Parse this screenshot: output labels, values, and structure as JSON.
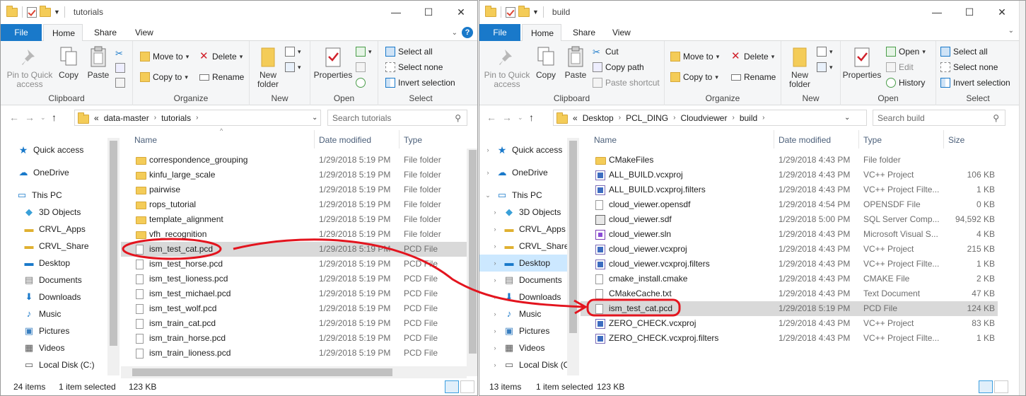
{
  "colors": {
    "accent": "#1979ca",
    "folder": "#f4cc58",
    "selected_row": "#d9d9d9",
    "nav_selected": "#cce8ff",
    "annotation": "#e3141e"
  },
  "left": {
    "title": "tutorials",
    "tabs": [
      "File",
      "Home",
      "Share",
      "View"
    ],
    "ribbon": {
      "clipboard": {
        "label": "Clipboard",
        "pin": "Pin to Quick access",
        "copy": "Copy",
        "paste": "Paste"
      },
      "organize": {
        "label": "Organize",
        "move_to": "Move to",
        "copy_to": "Copy to",
        "delete": "Delete",
        "rename": "Rename"
      },
      "new": {
        "label": "New",
        "new_folder": "New folder"
      },
      "open": {
        "label": "Open",
        "properties": "Properties"
      },
      "select": {
        "label": "Select",
        "select_all": "Select all",
        "select_none": "Select none",
        "invert": "Invert selection"
      }
    },
    "breadcrumb": [
      "«",
      "data-master",
      "tutorials"
    ],
    "search_placeholder": "Search tutorials",
    "nav": [
      {
        "label": "Quick access",
        "icon": "star-icon"
      },
      {
        "label": "OneDrive",
        "icon": "cloud-icon"
      },
      {
        "label": "This PC",
        "icon": "pc-icon"
      },
      {
        "label": "3D Objects",
        "icon": "cube-icon"
      },
      {
        "label": "CRVL_Apps",
        "icon": "folder-icon"
      },
      {
        "label": "CRVL_Share",
        "icon": "folder-icon"
      },
      {
        "label": "Desktop",
        "icon": "desktop-icon"
      },
      {
        "label": "Documents",
        "icon": "documents-icon"
      },
      {
        "label": "Downloads",
        "icon": "download-icon"
      },
      {
        "label": "Music",
        "icon": "music-icon"
      },
      {
        "label": "Pictures",
        "icon": "pictures-icon"
      },
      {
        "label": "Videos",
        "icon": "videos-icon"
      },
      {
        "label": "Local Disk (C:)",
        "icon": "disk-icon"
      }
    ],
    "columns": {
      "name": "Name",
      "date": "Date modified",
      "type": "Type"
    },
    "files": [
      {
        "name": "correspondence_grouping",
        "date": "1/29/2018 5:19 PM",
        "type": "File folder",
        "kind": "folder"
      },
      {
        "name": "kinfu_large_scale",
        "date": "1/29/2018 5:19 PM",
        "type": "File folder",
        "kind": "folder"
      },
      {
        "name": "pairwise",
        "date": "1/29/2018 5:19 PM",
        "type": "File folder",
        "kind": "folder"
      },
      {
        "name": "rops_tutorial",
        "date": "1/29/2018 5:19 PM",
        "type": "File folder",
        "kind": "folder"
      },
      {
        "name": "template_alignment",
        "date": "1/29/2018 5:19 PM",
        "type": "File folder",
        "kind": "folder"
      },
      {
        "name": "vfh_recognition",
        "date": "1/29/2018 5:19 PM",
        "type": "File folder",
        "kind": "folder"
      },
      {
        "name": "ism_test_cat.pcd",
        "date": "1/29/2018 5:19 PM",
        "type": "PCD File",
        "kind": "doc",
        "selected": true
      },
      {
        "name": "ism_test_horse.pcd",
        "date": "1/29/2018 5:19 PM",
        "type": "PCD File",
        "kind": "doc"
      },
      {
        "name": "ism_test_lioness.pcd",
        "date": "1/29/2018 5:19 PM",
        "type": "PCD File",
        "kind": "doc"
      },
      {
        "name": "ism_test_michael.pcd",
        "date": "1/29/2018 5:19 PM",
        "type": "PCD File",
        "kind": "doc"
      },
      {
        "name": "ism_test_wolf.pcd",
        "date": "1/29/2018 5:19 PM",
        "type": "PCD File",
        "kind": "doc"
      },
      {
        "name": "ism_train_cat.pcd",
        "date": "1/29/2018 5:19 PM",
        "type": "PCD File",
        "kind": "doc"
      },
      {
        "name": "ism_train_horse.pcd",
        "date": "1/29/2018 5:19 PM",
        "type": "PCD File",
        "kind": "doc"
      },
      {
        "name": "ism_train_lioness.pcd",
        "date": "1/29/2018 5:19 PM",
        "type": "PCD File",
        "kind": "doc"
      }
    ],
    "status": {
      "count": "24 items",
      "selected": "1 item selected",
      "size": "123 KB"
    }
  },
  "right": {
    "title": "build",
    "tabs": [
      "File",
      "Home",
      "Share",
      "View"
    ],
    "ribbon": {
      "clipboard": {
        "label": "Clipboard",
        "pin": "Pin to Quick access",
        "copy": "Copy",
        "paste": "Paste",
        "cut": "Cut",
        "copy_path": "Copy path",
        "paste_shortcut": "Paste shortcut"
      },
      "organize": {
        "label": "Organize",
        "move_to": "Move to",
        "copy_to": "Copy to",
        "delete": "Delete",
        "rename": "Rename"
      },
      "new": {
        "label": "New",
        "new_folder": "New folder"
      },
      "open": {
        "label": "Open",
        "properties": "Properties",
        "open": "Open",
        "edit": "Edit",
        "history": "History"
      },
      "select": {
        "label": "Select",
        "select_all": "Select all",
        "select_none": "Select none",
        "invert": "Invert selection"
      }
    },
    "breadcrumb": [
      "«",
      "Desktop",
      "PCL_DING",
      "Cloudviewer",
      "build"
    ],
    "search_placeholder": "Search build",
    "nav": [
      {
        "label": "Quick access",
        "icon": "star-icon",
        "exp": "›"
      },
      {
        "label": "OneDrive",
        "icon": "cloud-icon",
        "exp": "›"
      },
      {
        "label": "This PC",
        "icon": "pc-icon",
        "exp": "⌄"
      },
      {
        "label": "3D Objects",
        "icon": "cube-icon",
        "exp": "›"
      },
      {
        "label": "CRVL_Apps",
        "icon": "folder-icon",
        "exp": "›"
      },
      {
        "label": "CRVL_Share",
        "icon": "folder-icon",
        "exp": "›"
      },
      {
        "label": "Desktop",
        "icon": "desktop-icon",
        "exp": "›",
        "selected": true
      },
      {
        "label": "Documents",
        "icon": "documents-icon",
        "exp": "›"
      },
      {
        "label": "Downloads",
        "icon": "download-icon",
        "exp": "›"
      },
      {
        "label": "Music",
        "icon": "music-icon",
        "exp": "›"
      },
      {
        "label": "Pictures",
        "icon": "pictures-icon",
        "exp": "›"
      },
      {
        "label": "Videos",
        "icon": "videos-icon",
        "exp": "›"
      },
      {
        "label": "Local Disk (C:",
        "icon": "disk-icon",
        "exp": "›"
      }
    ],
    "columns": {
      "name": "Name",
      "date": "Date modified",
      "type": "Type",
      "size": "Size"
    },
    "files": [
      {
        "name": "CMakeFiles",
        "date": "1/29/2018 4:43 PM",
        "type": "File folder",
        "size": "",
        "kind": "folder"
      },
      {
        "name": "ALL_BUILD.vcxproj",
        "date": "1/29/2018 4:43 PM",
        "type": "VC++ Project",
        "size": "106 KB",
        "kind": "vc"
      },
      {
        "name": "ALL_BUILD.vcxproj.filters",
        "date": "1/29/2018 4:43 PM",
        "type": "VC++ Project Filte...",
        "size": "1 KB",
        "kind": "vc"
      },
      {
        "name": "cloud_viewer.opensdf",
        "date": "1/29/2018 4:54 PM",
        "type": "OPENSDF File",
        "size": "0 KB",
        "kind": "doc"
      },
      {
        "name": "cloud_viewer.sdf",
        "date": "1/29/2018 5:00 PM",
        "type": "SQL Server Comp...",
        "size": "94,592 KB",
        "kind": "sdf"
      },
      {
        "name": "cloud_viewer.sln",
        "date": "1/29/2018 4:43 PM",
        "type": "Microsoft Visual S...",
        "size": "4 KB",
        "kind": "sln"
      },
      {
        "name": "cloud_viewer.vcxproj",
        "date": "1/29/2018 4:43 PM",
        "type": "VC++ Project",
        "size": "215 KB",
        "kind": "vc"
      },
      {
        "name": "cloud_viewer.vcxproj.filters",
        "date": "1/29/2018 4:43 PM",
        "type": "VC++ Project Filte...",
        "size": "1 KB",
        "kind": "vc"
      },
      {
        "name": "cmake_install.cmake",
        "date": "1/29/2018 4:43 PM",
        "type": "CMAKE File",
        "size": "2 KB",
        "kind": "doc"
      },
      {
        "name": "CMakeCache.txt",
        "date": "1/29/2018 4:43 PM",
        "type": "Text Document",
        "size": "47 KB",
        "kind": "doc"
      },
      {
        "name": "ism_test_cat.pcd",
        "date": "1/29/2018 5:19 PM",
        "type": "PCD File",
        "size": "124 KB",
        "kind": "doc",
        "selected": true
      },
      {
        "name": "ZERO_CHECK.vcxproj",
        "date": "1/29/2018 4:43 PM",
        "type": "VC++ Project",
        "size": "83 KB",
        "kind": "vc"
      },
      {
        "name": "ZERO_CHECK.vcxproj.filters",
        "date": "1/29/2018 4:43 PM",
        "type": "VC++ Project Filte...",
        "size": "1 KB",
        "kind": "vc"
      }
    ],
    "status": {
      "count": "13 items",
      "selected": "1 item selected",
      "size": "123 KB"
    }
  }
}
